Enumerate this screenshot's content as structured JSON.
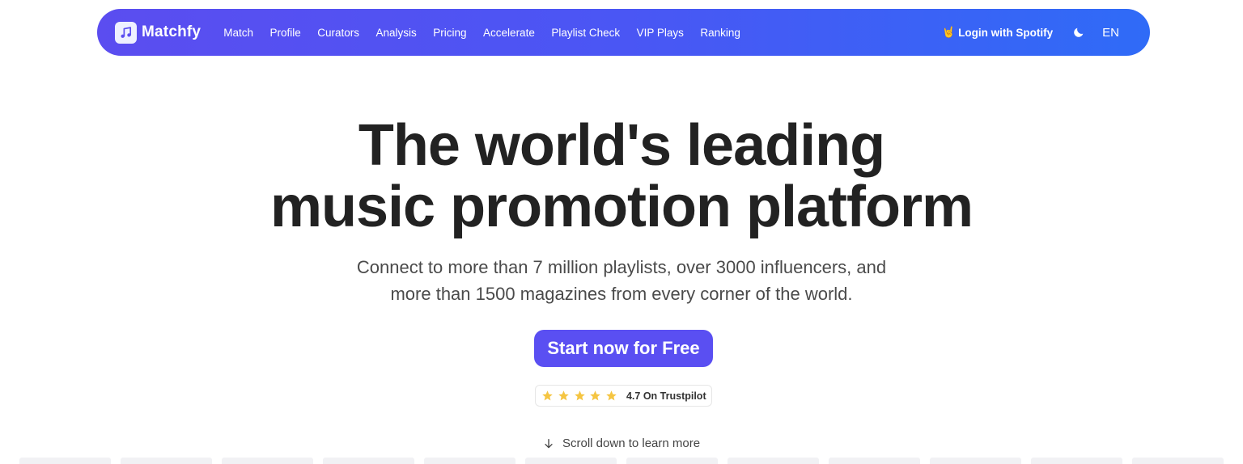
{
  "brand": {
    "name": "Matchfy",
    "logo_icon": "music-note-icon"
  },
  "nav": {
    "links": [
      "Match",
      "Profile",
      "Curators",
      "Analysis",
      "Pricing",
      "Accelerate",
      "Playlist Check",
      "VIP Plays",
      "Ranking"
    ],
    "login_emoji": "🤘",
    "login_label": "Login with Spotify",
    "theme_icon": "moon-icon",
    "language": "EN"
  },
  "hero": {
    "title_line1": "The world's leading",
    "title_line2": "music promotion platform",
    "subtitle_line1": "Connect to more than 7 million playlists, over 3000 influencers, and",
    "subtitle_line2": "more than 1500 magazines from every corner of the world.",
    "cta_label": "Start now for Free"
  },
  "trustpilot": {
    "rating": 5,
    "max": 5,
    "label": "4.7 On Trustpilot"
  },
  "scroll": {
    "label": "Scroll down to learn more",
    "icon": "arrow-down-icon"
  },
  "colors": {
    "nav_gradient_start": "#5b4df0",
    "nav_gradient_end": "#2f6bf7",
    "cta": "#5a4ff2",
    "star": "#f5c542",
    "text": "#222222"
  }
}
